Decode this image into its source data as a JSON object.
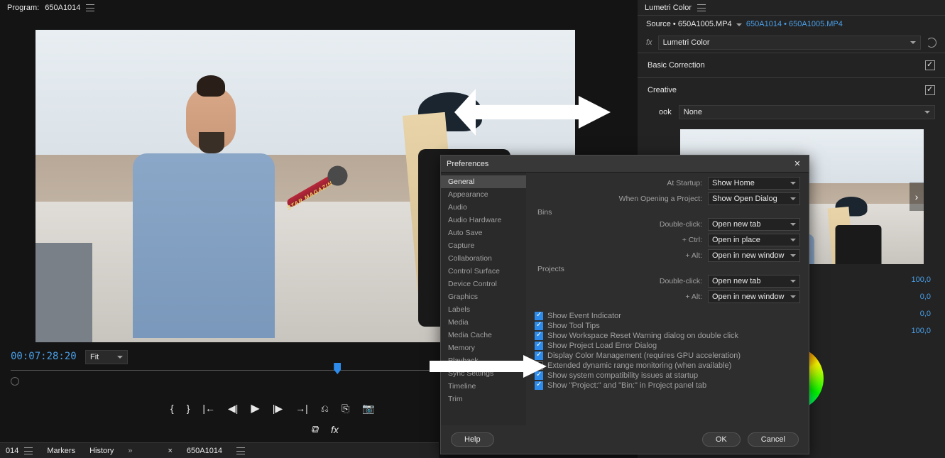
{
  "program": {
    "title_prefix": "Program:",
    "clip_name": "650A1014",
    "timecode": "00:07:28:20",
    "zoom": "Fit",
    "mic_label": "STAR MAGAZIN"
  },
  "transport": {
    "mark_in": "{",
    "mark_out": "}",
    "go_in": "|←",
    "step_back": "◀|",
    "play": "▶",
    "step_fwd": "|▶",
    "go_out": "→|",
    "lift": "⎌",
    "extract": "⎘",
    "export_frame": "📷"
  },
  "effects_row": {
    "comparison": "⧉",
    "fx": "fx"
  },
  "bottom_tabs": {
    "project_tab": "014",
    "markers": "Markers",
    "history": "History",
    "more": "»",
    "seq_tab": "650A1014"
  },
  "lumetri": {
    "panel_title": "Lumetri Color",
    "source_prefix": "Source",
    "source_clip": "650A1005.MP4",
    "master_link": "650A1014 • 650A1005.MP4",
    "fx_label": "fx",
    "effect_name": "Lumetri Color",
    "basic_correction": "Basic Correction",
    "creative": "Creative",
    "look_label": "ook",
    "look_value": "None",
    "sliders": [
      {
        "val": "100,0"
      },
      {
        "val": "0,0"
      },
      {
        "val": "0,0"
      },
      {
        "val": "100,0"
      }
    ]
  },
  "prefs": {
    "title": "Preferences",
    "nav": [
      "General",
      "Appearance",
      "Audio",
      "Audio Hardware",
      "Auto Save",
      "Capture",
      "Collaboration",
      "Control Surface",
      "Device Control",
      "Graphics",
      "Labels",
      "Media",
      "Media Cache",
      "Memory",
      "Playback",
      "Sync Settings",
      "Timeline",
      "Trim"
    ],
    "nav_selected": 0,
    "startup_label": "At Startup:",
    "startup_value": "Show Home",
    "open_label": "When Opening a Project:",
    "open_value": "Show Open Dialog",
    "bins_label": "Bins",
    "dblclick_label": "Double-click:",
    "dblclick_value": "Open new tab",
    "ctrl_label": "+ Ctrl:",
    "ctrl_value": "Open in place",
    "alt_label": "+ Alt:",
    "alt_value": "Open in new window",
    "projects_label": "Projects",
    "p_dblclick_value": "Open new tab",
    "p_alt_value": "Open in new window",
    "checks": [
      {
        "on": true,
        "label": "Show Event Indicator"
      },
      {
        "on": true,
        "label": "Show Tool Tips"
      },
      {
        "on": true,
        "label": "Show Workspace Reset Warning dialog on double click"
      },
      {
        "on": true,
        "label": "Show Project Load Error Dialog"
      },
      {
        "on": true,
        "label": "Display Color Management (requires GPU acceleration)"
      },
      {
        "on": false,
        "label": "Extended dynamic range monitoring (when available)"
      },
      {
        "on": true,
        "label": "Show system compatibility issues at startup"
      },
      {
        "on": true,
        "label": "Show \"Project:\" and \"Bin:\" in Project panel tab"
      }
    ],
    "help": "Help",
    "ok": "OK",
    "cancel": "Cancel"
  }
}
